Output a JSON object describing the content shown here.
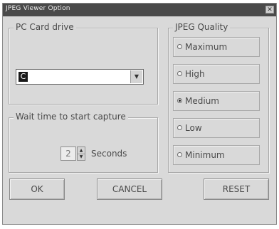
{
  "window": {
    "title": "JPEG Viewer Option",
    "close_glyph": "✕"
  },
  "pc_card": {
    "legend": "PC Card drive",
    "selected_value": "C",
    "arrow_glyph": "▼"
  },
  "wait_time": {
    "legend": "Wait time to start capture",
    "value": "2",
    "unit_label": "Seconds",
    "up_glyph": "▲",
    "down_glyph": "▼"
  },
  "jpeg_quality": {
    "legend": "JPEG Quality",
    "selected": "Medium",
    "options": [
      {
        "label": "Maximum",
        "checked": false
      },
      {
        "label": "High",
        "checked": false
      },
      {
        "label": "Medium",
        "checked": true
      },
      {
        "label": "Low",
        "checked": false
      },
      {
        "label": "Minimum",
        "checked": false
      }
    ]
  },
  "buttons": {
    "ok": "OK",
    "cancel": "CANCEL",
    "reset": "RESET"
  },
  "icons": {
    "close": "close-icon",
    "dropdown": "chevron-down-icon",
    "spin_up": "chevron-up-icon",
    "spin_down": "chevron-down-icon"
  }
}
